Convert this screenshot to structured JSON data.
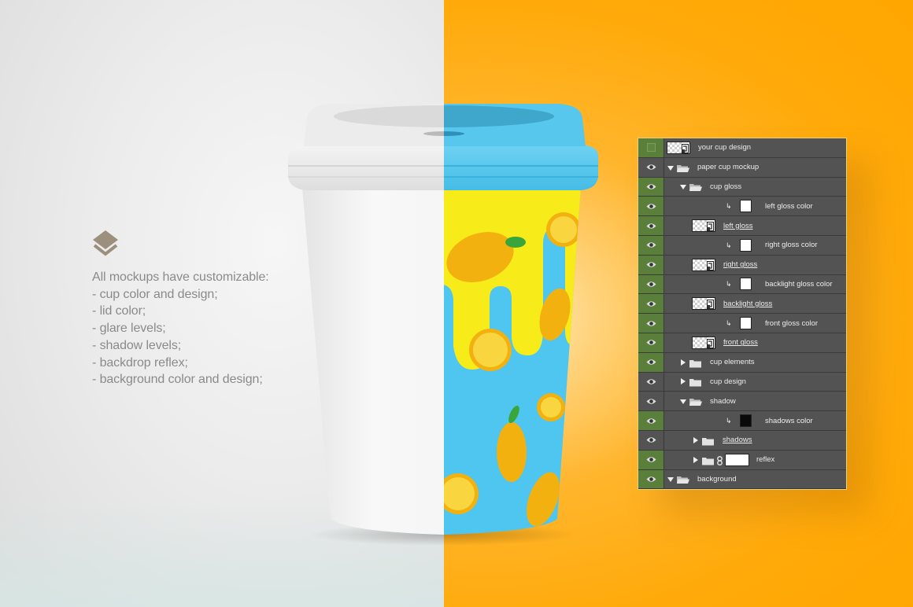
{
  "features": {
    "icon": "layers-icon",
    "heading": "All mockups have customizable:",
    "items": [
      "- cup color and design;",
      "- lid color;",
      "- glare levels;",
      "- shadow levels;",
      "- backdrop reflex;",
      "- background color and design;"
    ]
  },
  "colors": {
    "left_background": "#e8e8e8",
    "right_background": "#ffaa0a",
    "lid_blue": "#5cc8ec",
    "cup_blue": "#4fc6ef",
    "cup_yellow": "#f7ec1a",
    "lemon": "#f2b10f",
    "leaf": "#3aa53a",
    "panel": "#535353",
    "eye_active": "#5a7f3a"
  },
  "layers_panel": {
    "rows": [
      {
        "name": "your cup design",
        "indent": 0,
        "kind": "smart-object",
        "visibility": "empty",
        "highlight": true,
        "underline": false
      },
      {
        "name": "paper cup mockup",
        "indent": 0,
        "kind": "group-open",
        "visibility": "eye",
        "highlight": false,
        "underline": false
      },
      {
        "name": "cup gloss",
        "indent": 1,
        "kind": "group-open",
        "visibility": "eye",
        "highlight": true,
        "underline": false
      },
      {
        "name": "left gloss color",
        "indent": 2,
        "kind": "fill-white",
        "visibility": "eye",
        "highlight": true,
        "underline": false
      },
      {
        "name": "left gloss",
        "indent": 2,
        "kind": "smart-object",
        "visibility": "eye",
        "highlight": true,
        "underline": true
      },
      {
        "name": "right gloss color",
        "indent": 2,
        "kind": "fill-white",
        "visibility": "eye",
        "highlight": true,
        "underline": false
      },
      {
        "name": "right gloss",
        "indent": 2,
        "kind": "smart-object",
        "visibility": "eye",
        "highlight": true,
        "underline": true
      },
      {
        "name": "backlight gloss color",
        "indent": 2,
        "kind": "fill-white",
        "visibility": "eye",
        "highlight": true,
        "underline": false
      },
      {
        "name": "backlight gloss",
        "indent": 2,
        "kind": "smart-object",
        "visibility": "eye",
        "highlight": true,
        "underline": true
      },
      {
        "name": "front gloss color",
        "indent": 2,
        "kind": "fill-white",
        "visibility": "eye",
        "highlight": true,
        "underline": false
      },
      {
        "name": "front gloss",
        "indent": 2,
        "kind": "smart-object",
        "visibility": "eye",
        "highlight": true,
        "underline": true
      },
      {
        "name": "cup elements",
        "indent": 1,
        "kind": "group-closed",
        "visibility": "eye",
        "highlight": true,
        "underline": false
      },
      {
        "name": "cup design",
        "indent": 1,
        "kind": "group-closed",
        "visibility": "eye",
        "highlight": false,
        "underline": false
      },
      {
        "name": "shadow",
        "indent": 1,
        "kind": "group-open",
        "visibility": "eye",
        "highlight": false,
        "underline": false
      },
      {
        "name": "shadows color",
        "indent": 2,
        "kind": "fill-black",
        "visibility": "eye",
        "highlight": true,
        "underline": false
      },
      {
        "name": "shadows",
        "indent": 2,
        "kind": "group-closed",
        "visibility": "eye",
        "highlight": false,
        "underline": true
      },
      {
        "name": "reflex",
        "indent": 2,
        "kind": "group-closed-mask",
        "visibility": "eye",
        "highlight": true,
        "underline": false
      },
      {
        "name": "background",
        "indent": 0,
        "kind": "group-open",
        "visibility": "eye",
        "highlight": true,
        "underline": false
      }
    ]
  }
}
